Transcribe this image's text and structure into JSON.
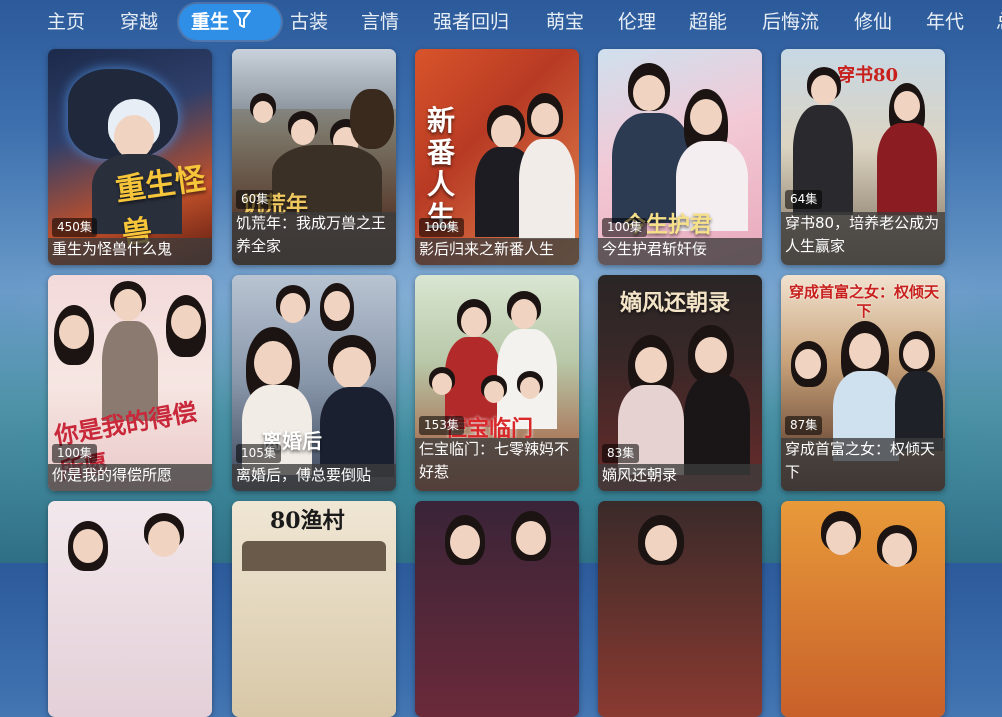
{
  "nav": {
    "items": [
      "主页",
      "穿越",
      "重生",
      "古装",
      "言情",
      "强者回归",
      "萌宝",
      "伦理",
      "超能",
      "后悔流",
      "修仙",
      "年代",
      "总"
    ],
    "active": "重生"
  },
  "cards": [
    {
      "title": "重生为怪兽什么鬼",
      "episodes": "450集",
      "art_text": "重生怪兽"
    },
    {
      "title": "饥荒年：我成万兽之王养全家",
      "episodes": "60集",
      "art_text": "饥荒年"
    },
    {
      "title": "影后归来之新番人生",
      "episodes": "100集",
      "art_text": "新番人生"
    },
    {
      "title": "今生护君斩奸佞",
      "episodes": "100集",
      "art_text": "今生护君"
    },
    {
      "title": "穿书80，培养老公成为人生赢家",
      "episodes": "64集",
      "art_text": "穿书80"
    },
    {
      "title": "你是我的得偿所愿",
      "episodes": "100集",
      "art_text": "你是我的得偿所愿"
    },
    {
      "title": "离婚后，傅总要倒贴",
      "episodes": "105集",
      "art_text": "离婚后"
    },
    {
      "title": "仨宝临门：七零辣妈不好惹",
      "episodes": "153集",
      "art_text": "仨宝临门"
    },
    {
      "title": "嫡风还朝录",
      "episodes": "83集",
      "art_text": "嫡风还朝录"
    },
    {
      "title": "穿成首富之女：权倾天下",
      "episodes": "87集",
      "art_text": "穿成首富之女：权倾天下"
    },
    {
      "title": "",
      "episodes": "",
      "art_text": ""
    },
    {
      "title": "",
      "episodes": "",
      "art_text": "80渔村"
    },
    {
      "title": "",
      "episodes": "",
      "art_text": ""
    },
    {
      "title": "",
      "episodes": "",
      "art_text": ""
    },
    {
      "title": "",
      "episodes": "",
      "art_text": ""
    }
  ],
  "colors": {
    "accent": "#2f8fe6",
    "caption_bg": "#3c3c3c"
  },
  "icons": {
    "filter": "filter-icon"
  }
}
